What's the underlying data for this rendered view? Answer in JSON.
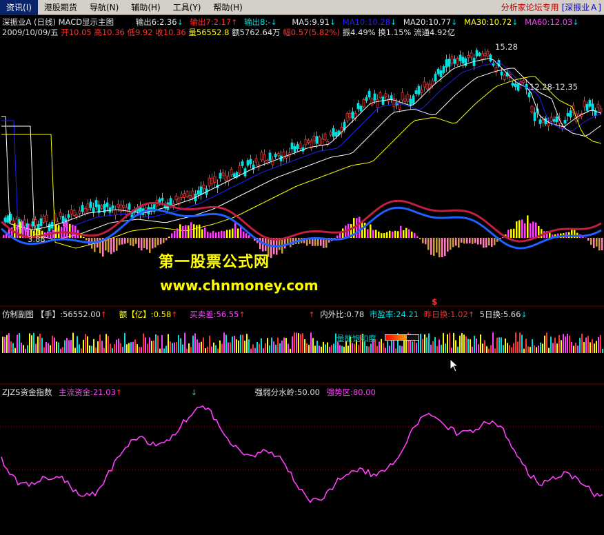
{
  "menu": {
    "items": [
      {
        "label": "资讯"
      },
      {
        "label": "港股期货"
      },
      {
        "label": "导航"
      },
      {
        "label": "辅助"
      },
      {
        "label": "工具"
      },
      {
        "label": "帮助"
      }
    ],
    "accel": [
      "(I)",
      "",
      "(N)",
      "(H)",
      "(Y)",
      "(H)"
    ],
    "forum": "分析家论坛专用",
    "stock": "[深振业Ａ]"
  },
  "header": {
    "title": "深振业A (日线) MACD显示主图",
    "out6": "输出6:2.36",
    "out7": "输出7:2.17",
    "out8": "输出8:-",
    "ma5": "MA5:9.91",
    "ma10": "MA10:10.28",
    "ma20": "MA20:10.77",
    "ma30": "MA30:10.72",
    "ma60": "MA60:12.03"
  },
  "quote": {
    "date": "2009/10/09/五",
    "open": "开10.05",
    "high": "高10.36",
    "low": "低9.92",
    "close": "收10.36",
    "vol": "量56552.8",
    "amount": "额5762.64万",
    "change": "幅0.57(5.82%)",
    "amp": "振4.49%",
    "turnover": "换1.15%",
    "float": "流通4.92亿"
  },
  "price_labels": {
    "peak": "15.28",
    "mid": "12.28-12.35",
    "low": "3.88"
  },
  "watermark": {
    "line1": "第一股票公式网",
    "line2": "www.chnmoney.com"
  },
  "sub1": {
    "title": "仿制副图 【手】:56552.00",
    "amount": "额【亿】:0.58",
    "buysell": "买卖差:56.55",
    "inout": "内外比:0.78",
    "pe": "市盈率:24.21",
    "yday": "昨日换:1.02",
    "day5": "5日换:5.66",
    "dollar": "$",
    "saturation": "量能饱和度"
  },
  "sub2": {
    "title": "ZJZS资金指数",
    "main_fund": "主流资金:21.03",
    "divide": "强弱分水岭:50.00",
    "strong": "强势区:80.00"
  },
  "colors": {
    "up": "#ff3232",
    "down": "#00e0e0",
    "ma5": "#ffffff",
    "ma10": "#0000ff",
    "ma20": "#ffffff",
    "ma30": "#ffff00",
    "ma60": "#ff00ff",
    "fund": "#ff40ff"
  },
  "icons": [
    "mouse-cursor-icon",
    "up-arrow-icon",
    "down-arrow-icon"
  ]
}
